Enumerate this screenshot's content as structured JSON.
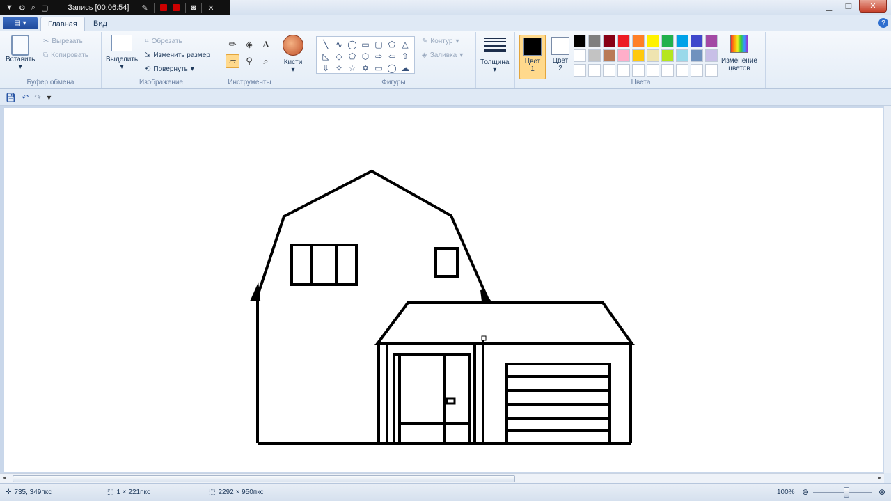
{
  "recorder": {
    "title": "Запись [00:06:54]"
  },
  "tabs": {
    "home": "Главная",
    "view": "Вид"
  },
  "clipboard": {
    "paste": "Вставить",
    "cut": "Вырезать",
    "copy": "Копировать",
    "label": "Буфер обмена"
  },
  "image": {
    "select": "Выделить",
    "crop": "Обрезать",
    "resize": "Изменить размер",
    "rotate": "Повернуть",
    "label": "Изображение"
  },
  "tools": {
    "label": "Инструменты",
    "brushes": "Кисти",
    "text_tool_glyph": "A"
  },
  "shapes": {
    "label": "Фигуры",
    "outline": "Контур",
    "fill": "Заливка"
  },
  "size": {
    "label": "Толщина"
  },
  "colors": {
    "label": "Цвета",
    "color1": "Цвет 1",
    "color2": "Цвет 2",
    "edit": "Изменение цветов",
    "palette": [
      "#000000",
      "#7f7f7f",
      "#880015",
      "#ed1c24",
      "#ff7f27",
      "#fff200",
      "#22b14c",
      "#00a2e8",
      "#3f48cc",
      "#a349a4",
      "#ffffff",
      "#c3c3c3",
      "#b97a57",
      "#ffaec9",
      "#ffc90e",
      "#efe4b0",
      "#b5e61d",
      "#99d9ea",
      "#7092be",
      "#c8bfe7",
      "#ffffff",
      "#ffffff",
      "#ffffff",
      "#ffffff",
      "#ffffff",
      "#ffffff",
      "#ffffff",
      "#ffffff",
      "#ffffff",
      "#ffffff"
    ],
    "color1_value": "#000000",
    "color2_value": "#ffffff"
  },
  "status": {
    "cursor": "735, 349пкс",
    "selection": "1 × 221пкс",
    "image_size": "2292 × 950пкс",
    "zoom": "100%"
  }
}
